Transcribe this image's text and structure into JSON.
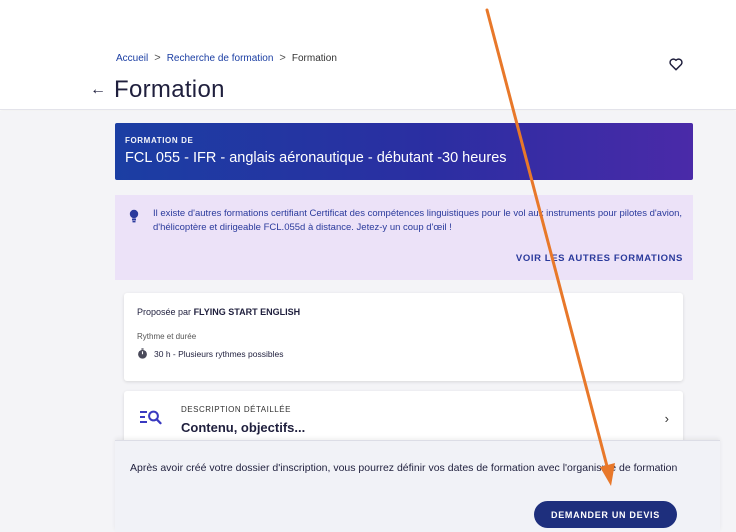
{
  "breadcrumb": {
    "home": "Accueil",
    "search": "Recherche de formation",
    "current": "Formation",
    "separator": ">"
  },
  "header": {
    "back_glyph": "←",
    "title": "Formation",
    "favorite_icon": "heart-outline-icon"
  },
  "hero": {
    "kicker": "FORMATION DE",
    "title": "FCL 055 - IFR - anglais aéronautique - débutant -30 heures"
  },
  "notice": {
    "icon": "lightbulb-icon",
    "text": "Il existe d'autres formations certifiant Certificat des compétences linguistiques pour le vol aux instruments pour pilotes d'avion, d'hélicoptère et dirigeable FCL.055d à distance. Jetez-y un coup d'œil !",
    "link_label": "VOIR LES AUTRES FORMATIONS"
  },
  "provider_card": {
    "offered_prefix": "Proposée par",
    "provider": "FLYING START ENGLISH",
    "rhythm_label": "Rythme et durée",
    "rhythm_value": "30 h - Plusieurs rythmes possibles",
    "rhythm_icon": "stopwatch-icon"
  },
  "description_card": {
    "icon": "search-list-icon",
    "kicker": "DESCRIPTION DÉTAILLÉE",
    "title": "Contenu, objectifs...",
    "chevron": "›"
  },
  "bottom_panel": {
    "text": "Après avoir créé votre dossier d'inscription, vous pourrez définir vos dates de formation avec l'organisme de formation",
    "cta_label": "DEMANDER UN DEVIS"
  },
  "colors": {
    "primary": "#1b3ea3",
    "cta": "#1e2f7d",
    "notice_bg": "#ece2f8",
    "annotation_arrow": "#e8782a"
  }
}
